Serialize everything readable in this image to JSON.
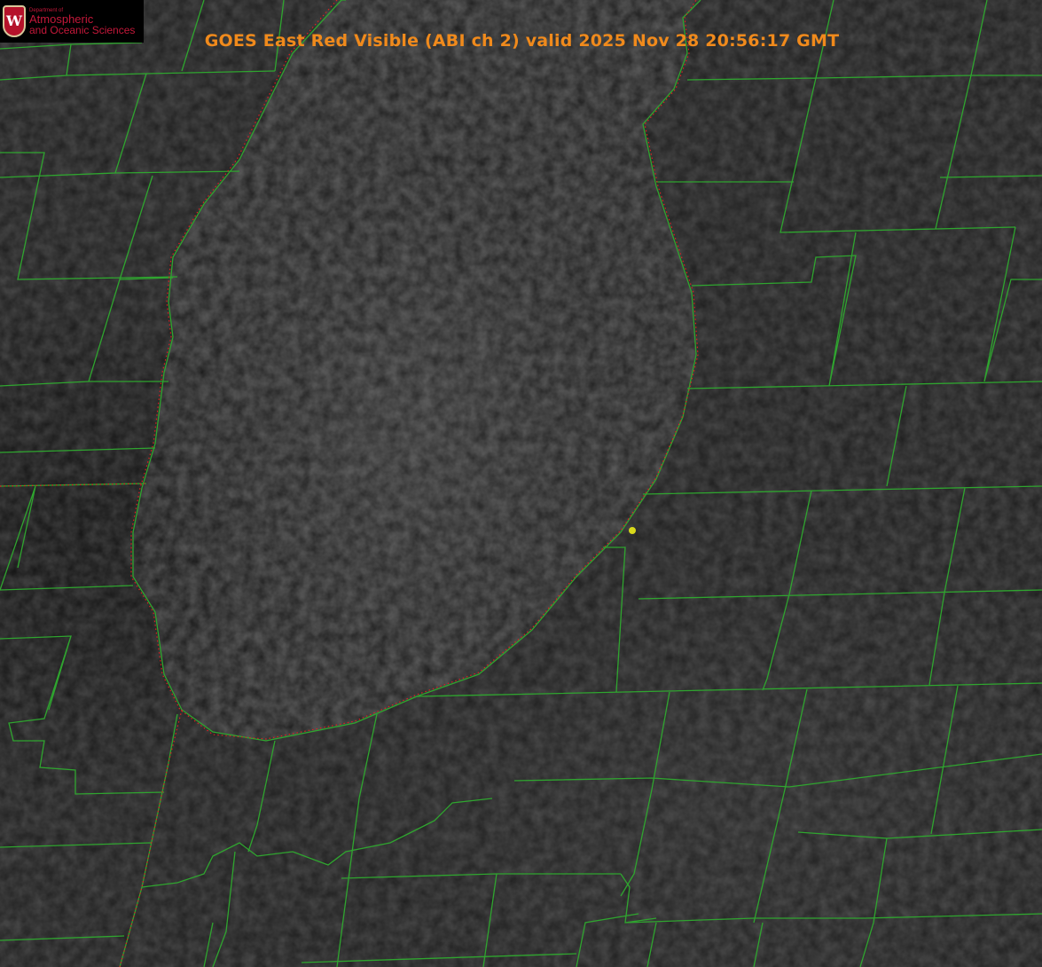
{
  "title": "GOES East Red Visible (ABI ch 2) valid 2025 Nov 28 20:56:17 GMT",
  "logo": {
    "department": "Department of",
    "line1": "Atmospheric",
    "line2": "and Oceanic Sciences",
    "crest_letter": "W"
  },
  "colors": {
    "title": "#f08a1c",
    "borders": "#2fa52f",
    "state_border": "#e02020",
    "marker": "#d8d81a"
  }
}
